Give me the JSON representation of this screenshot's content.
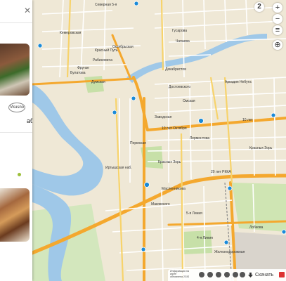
{
  "map": {
    "street_labels": {
      "severnaya_5": "Северная 5-я",
      "kemerovskaya": "Кемеровская",
      "krasny_put_top": "Красный Путь",
      "rabinovicha": "Рабиновича",
      "frunze": "Фрунзе",
      "bulatova": "Булатова",
      "dumskaya": "Думская",
      "oktyabrskaya": "Октябрьская",
      "gusarova": "Гусарова",
      "chapaeva": "Чапаева",
      "dekabristov": "Декабристов",
      "dostoevskogo": "Достоевского",
      "omskaya": "Омская",
      "arkadiya_nebuta": "Аркадия Небута",
      "zavodskaya": "Заводская",
      "10_let_oktyabrya": "10 лет Октября",
      "permskaya": "Пермская",
      "lermontova": "Лермонтова",
      "krasnykh_zor_l": "Красных Зорь",
      "krasnykh_zor_r": "Красных Зорь",
      "20_let_rkka": "20 лет РККА",
      "maslennikova": "Масленникова",
      "makovskogo": "Маковского",
      "5_ya_liniya": "5-я Линия",
      "lobkova": "Лобкова",
      "kuybysheva": "Куйбышева",
      "irtyshskaya": "Иртышская наб.",
      "chernyshevskogo": "Чернышевского",
      "proletarskaya": "Пролетарская",
      "sovetskaya": "Советская",
      "putilova": "Путилова",
      "ermaka": "Ермака",
      "nekrasova": "Некрасова",
      "pushkina": "Пушкина",
      "gagarina": "Гагарина",
      "dmitrieva": "Дмитриева",
      "zhukova": "Жукова",
      "bratskaya": "Братская",
      "serova": "Серова",
      "rzhaksa": "Ржакса",
      "zheleznodorozhnaya": "Железнодорожная",
      "4_ya_liniya": "4-я Линия",
      "1_ya_liniya": "1-я Линия",
      "kuybysheva_low": "Куйбышева",
      "leningradskaya": "Ленинградская",
      "10_let": "10 лет"
    }
  },
  "controls": {
    "floors_badge": "2",
    "zoom_in": "+",
    "zoom_out": "−",
    "menu_icon": "hamburger-icon",
    "locate_icon": "target-icon"
  },
  "panel": {
    "close_icon": "close-icon",
    "text_fragment": "аб!",
    "logo_text": "Vkusno"
  },
  "bottom_bar": {
    "copyright_line1": "Информация на карте",
    "copyright_line2": "обновлена 2GIS",
    "download_label": "Скачать"
  },
  "colors": {
    "land": "#efe8d6",
    "river": "#9fc8e8",
    "park": "#c7e0a8",
    "major_road": "#f4a82e",
    "minor_road": "#ffffff",
    "marker": "#1a8ad8"
  }
}
